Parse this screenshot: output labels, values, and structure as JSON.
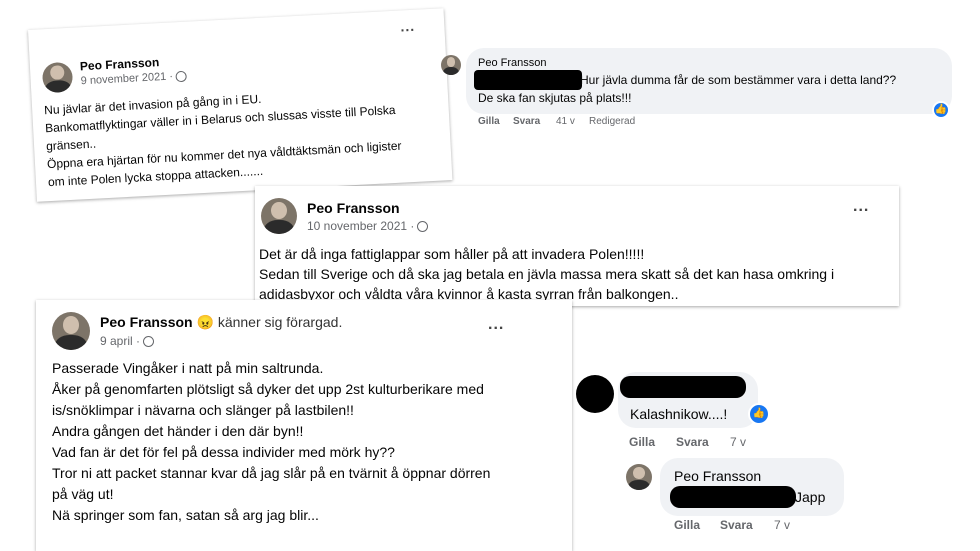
{
  "post1": {
    "author": "Peo Fransson",
    "date": "9 november 2021 ·",
    "more": "...",
    "lines": [
      "Nu jävlar är det invasion på gång in i EU.",
      "Bankomatflyktingar väller in i Belarus och slussas visste till Polska",
      "gränsen..",
      "Öppna era hjärtan för nu kommer det nya våldtäktsmän och ligister",
      "om inte Polen lycka stoppa attacken......."
    ]
  },
  "comment1": {
    "author": "Peo Fransson",
    "line1": "Hur jävla dumma får de som bestämmer vara i detta land??",
    "line2": "De ska fan skjutas på plats!!!",
    "actions": {
      "like": "Gilla",
      "reply": "Svara",
      "time": "41 v",
      "edited": "Redigerad"
    }
  },
  "post2": {
    "author": "Peo Fransson",
    "date": "10 november 2021 ·",
    "more": "...",
    "lines": [
      "Det är då inga fattiglappar som håller på att invadera Polen!!!!!",
      "Sedan till Sverige och då ska jag betala en jävla massa mera skatt så det kan hasa omkring i",
      "adidasbyxor och våldta våra kvinnor å kasta syrran från balkongen.."
    ]
  },
  "post3": {
    "author": "Peo Fransson",
    "feeling_emoji": "😠",
    "feeling": "känner sig förargad.",
    "date": "9 april ·",
    "more": "...",
    "lines": [
      "Passerade Vingåker i natt på min saltrunda.",
      "Åker på genomfarten plötsligt så dyker det upp 2st kulturberikare med",
      "is/snöklimpar i nävarna och slänger på lastbilen!!",
      "Andra gången det händer i den där byn!!",
      "Vad fan är det för fel på dessa individer med mörk hy??",
      "Tror ni att packet stannar kvar då jag slår på en tvärnit å öppnar dörren",
      "på väg ut!",
      "Nä springer som fan, satan så arg jag blir..."
    ]
  },
  "comment2": {
    "text": "Kalashnikow....!",
    "actions": {
      "like": "Gilla",
      "reply": "Svara",
      "time": "7 v"
    }
  },
  "comment3": {
    "author": "Peo Fransson",
    "text": "Japp",
    "actions": {
      "like": "Gilla",
      "reply": "Svara",
      "time": "7 v"
    }
  },
  "icons": {
    "like": "like-thumb-icon",
    "globe": "globe-icon",
    "more": "more-dots-icon"
  },
  "colors": {
    "like_blue": "#1877f2",
    "meta_gray": "#65676b",
    "bubble_bg": "#f0f2f5"
  }
}
